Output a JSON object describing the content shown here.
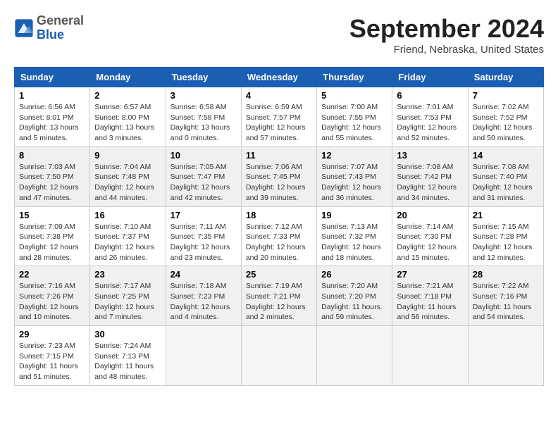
{
  "header": {
    "logo_general": "General",
    "logo_blue": "Blue",
    "month_title": "September 2024",
    "location": "Friend, Nebraska, United States"
  },
  "weekdays": [
    "Sunday",
    "Monday",
    "Tuesday",
    "Wednesday",
    "Thursday",
    "Friday",
    "Saturday"
  ],
  "weeks": [
    [
      {
        "day": "1",
        "info": "Sunrise: 6:56 AM\nSunset: 8:01 PM\nDaylight: 13 hours\nand 5 minutes."
      },
      {
        "day": "2",
        "info": "Sunrise: 6:57 AM\nSunset: 8:00 PM\nDaylight: 13 hours\nand 3 minutes."
      },
      {
        "day": "3",
        "info": "Sunrise: 6:58 AM\nSunset: 7:58 PM\nDaylight: 13 hours\nand 0 minutes."
      },
      {
        "day": "4",
        "info": "Sunrise: 6:59 AM\nSunset: 7:57 PM\nDaylight: 12 hours\nand 57 minutes."
      },
      {
        "day": "5",
        "info": "Sunrise: 7:00 AM\nSunset: 7:55 PM\nDaylight: 12 hours\nand 55 minutes."
      },
      {
        "day": "6",
        "info": "Sunrise: 7:01 AM\nSunset: 7:53 PM\nDaylight: 12 hours\nand 52 minutes."
      },
      {
        "day": "7",
        "info": "Sunrise: 7:02 AM\nSunset: 7:52 PM\nDaylight: 12 hours\nand 50 minutes."
      }
    ],
    [
      {
        "day": "8",
        "info": "Sunrise: 7:03 AM\nSunset: 7:50 PM\nDaylight: 12 hours\nand 47 minutes."
      },
      {
        "day": "9",
        "info": "Sunrise: 7:04 AM\nSunset: 7:48 PM\nDaylight: 12 hours\nand 44 minutes."
      },
      {
        "day": "10",
        "info": "Sunrise: 7:05 AM\nSunset: 7:47 PM\nDaylight: 12 hours\nand 42 minutes."
      },
      {
        "day": "11",
        "info": "Sunrise: 7:06 AM\nSunset: 7:45 PM\nDaylight: 12 hours\nand 39 minutes."
      },
      {
        "day": "12",
        "info": "Sunrise: 7:07 AM\nSunset: 7:43 PM\nDaylight: 12 hours\nand 36 minutes."
      },
      {
        "day": "13",
        "info": "Sunrise: 7:08 AM\nSunset: 7:42 PM\nDaylight: 12 hours\nand 34 minutes."
      },
      {
        "day": "14",
        "info": "Sunrise: 7:08 AM\nSunset: 7:40 PM\nDaylight: 12 hours\nand 31 minutes."
      }
    ],
    [
      {
        "day": "15",
        "info": "Sunrise: 7:09 AM\nSunset: 7:38 PM\nDaylight: 12 hours\nand 28 minutes."
      },
      {
        "day": "16",
        "info": "Sunrise: 7:10 AM\nSunset: 7:37 PM\nDaylight: 12 hours\nand 26 minutes."
      },
      {
        "day": "17",
        "info": "Sunrise: 7:11 AM\nSunset: 7:35 PM\nDaylight: 12 hours\nand 23 minutes."
      },
      {
        "day": "18",
        "info": "Sunrise: 7:12 AM\nSunset: 7:33 PM\nDaylight: 12 hours\nand 20 minutes."
      },
      {
        "day": "19",
        "info": "Sunrise: 7:13 AM\nSunset: 7:32 PM\nDaylight: 12 hours\nand 18 minutes."
      },
      {
        "day": "20",
        "info": "Sunrise: 7:14 AM\nSunset: 7:30 PM\nDaylight: 12 hours\nand 15 minutes."
      },
      {
        "day": "21",
        "info": "Sunrise: 7:15 AM\nSunset: 7:28 PM\nDaylight: 12 hours\nand 12 minutes."
      }
    ],
    [
      {
        "day": "22",
        "info": "Sunrise: 7:16 AM\nSunset: 7:26 PM\nDaylight: 12 hours\nand 10 minutes."
      },
      {
        "day": "23",
        "info": "Sunrise: 7:17 AM\nSunset: 7:25 PM\nDaylight: 12 hours\nand 7 minutes."
      },
      {
        "day": "24",
        "info": "Sunrise: 7:18 AM\nSunset: 7:23 PM\nDaylight: 12 hours\nand 4 minutes."
      },
      {
        "day": "25",
        "info": "Sunrise: 7:19 AM\nSunset: 7:21 PM\nDaylight: 12 hours\nand 2 minutes."
      },
      {
        "day": "26",
        "info": "Sunrise: 7:20 AM\nSunset: 7:20 PM\nDaylight: 11 hours\nand 59 minutes."
      },
      {
        "day": "27",
        "info": "Sunrise: 7:21 AM\nSunset: 7:18 PM\nDaylight: 11 hours\nand 56 minutes."
      },
      {
        "day": "28",
        "info": "Sunrise: 7:22 AM\nSunset: 7:16 PM\nDaylight: 11 hours\nand 54 minutes."
      }
    ],
    [
      {
        "day": "29",
        "info": "Sunrise: 7:23 AM\nSunset: 7:15 PM\nDaylight: 11 hours\nand 51 minutes."
      },
      {
        "day": "30",
        "info": "Sunrise: 7:24 AM\nSunset: 7:13 PM\nDaylight: 11 hours\nand 48 minutes."
      },
      {
        "day": "",
        "info": ""
      },
      {
        "day": "",
        "info": ""
      },
      {
        "day": "",
        "info": ""
      },
      {
        "day": "",
        "info": ""
      },
      {
        "day": "",
        "info": ""
      }
    ]
  ]
}
